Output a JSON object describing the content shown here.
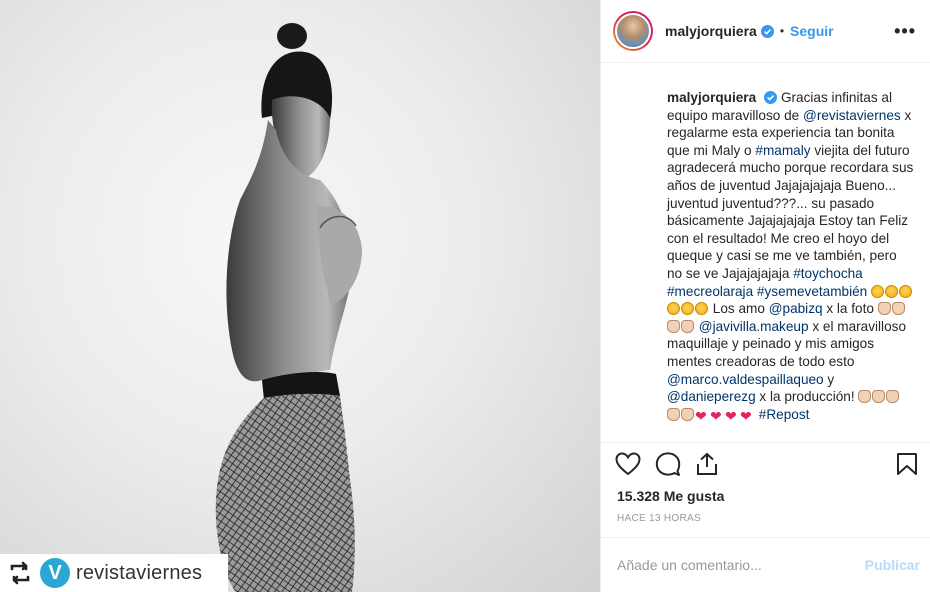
{
  "photo": {
    "repost_icon": "repost-icon",
    "brand_logo_letter": "V",
    "brand_handle": "revistaviernes"
  },
  "header": {
    "username": "malyjorquiera",
    "verified_icon": "verified-badge-icon",
    "separator": "•",
    "follow_label": "Seguir",
    "more_label": "•••"
  },
  "caption": {
    "username": "malyjorquiera",
    "segments": [
      {
        "t": "text",
        "v": "Gracias infinitas al equipo maravilloso de "
      },
      {
        "t": "link",
        "v": "@revistaviernes"
      },
      {
        "t": "text",
        "v": " x regalarme esta experiencia tan bonita que mi Maly o "
      },
      {
        "t": "link",
        "v": "#mamaly"
      },
      {
        "t": "text",
        "v": " viejita del futuro agradecerá mucho porque recordara sus años de juventud Jajajajajaja Bueno... juventud juventud???... su pasado básicamente Jajajajajaja Estoy tan Feliz con el resultado! Me creo el hoyo del queque y casi se me ve también, pero no se ve Jajajajajaja "
      },
      {
        "t": "link",
        "v": "#toychocha"
      },
      {
        "t": "text",
        "v": " "
      },
      {
        "t": "link",
        "v": "#mecreolaraja"
      },
      {
        "t": "text",
        "v": " "
      },
      {
        "t": "link",
        "v": "#ysemevetambién"
      },
      {
        "t": "text",
        "v": " "
      },
      {
        "t": "emoji",
        "v": "laugh",
        "n": 6
      },
      {
        "t": "text",
        "v": " Los amo "
      },
      {
        "t": "link",
        "v": "@pabizq"
      },
      {
        "t": "text",
        "v": " x la foto "
      },
      {
        "t": "emoji",
        "v": "clap",
        "n": 4
      },
      {
        "t": "text",
        "v": " "
      },
      {
        "t": "link",
        "v": "@javivilla.makeup"
      },
      {
        "t": "text",
        "v": " x el maravilloso maquillaje y peinado y mis amigos mentes creadoras de todo esto "
      },
      {
        "t": "link",
        "v": "@marco.valdespaillaqueo"
      },
      {
        "t": "text",
        "v": " y "
      },
      {
        "t": "link",
        "v": "@danieperezg"
      },
      {
        "t": "text",
        "v": " x la producción! "
      },
      {
        "t": "emoji",
        "v": "clap",
        "n": 5
      },
      {
        "t": "emoji",
        "v": "heart",
        "n": 4
      },
      {
        "t": "text",
        "v": " "
      },
      {
        "t": "link",
        "v": "#Repost"
      }
    ]
  },
  "actions": {
    "like_icon": "heart-icon",
    "comment_icon": "comment-icon",
    "share_icon": "share-icon",
    "save_icon": "bookmark-icon"
  },
  "likes_text": "15.328 Me gusta",
  "timestamp": "HACE 13 HORAS",
  "comment": {
    "placeholder": "Añade un comentario...",
    "publish_label": "Publicar"
  },
  "colors": {
    "link": "#003569",
    "follow": "#3897f0",
    "publish_disabled": "#b3dbff",
    "brand_logo": "#2aa7d5"
  }
}
